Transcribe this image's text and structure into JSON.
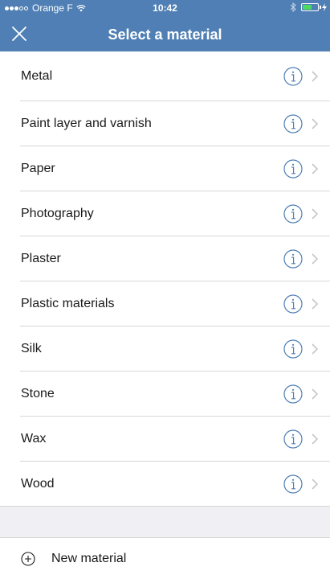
{
  "status_bar": {
    "carrier": "Orange F",
    "time": "10:42",
    "signal_bars_filled": 3,
    "signal_bars_total": 5
  },
  "nav": {
    "title": "Select a material",
    "close_icon": "close-icon"
  },
  "materials": [
    {
      "label": "Metal"
    },
    {
      "label": "Paint layer and varnish"
    },
    {
      "label": "Paper"
    },
    {
      "label": "Photography"
    },
    {
      "label": "Plaster"
    },
    {
      "label": "Plastic materials"
    },
    {
      "label": "Silk"
    },
    {
      "label": "Stone"
    },
    {
      "label": "Wax"
    },
    {
      "label": "Wood"
    }
  ],
  "footer": {
    "new_material_label": "New material",
    "new_material_icon": "plus-circle-icon"
  },
  "colors": {
    "header": "#4f7fb4",
    "accent": "#4f7fb4",
    "separator_band": "#efeff4",
    "battery": "#4cd964"
  }
}
